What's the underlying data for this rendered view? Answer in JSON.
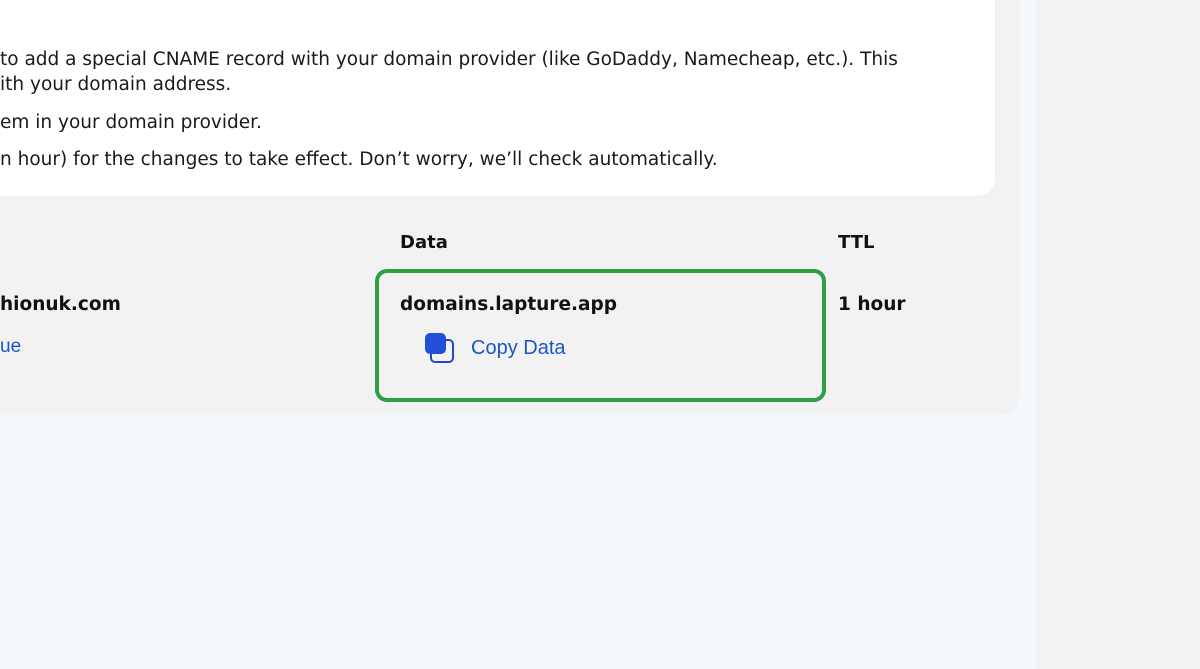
{
  "instructions": {
    "line1": "to add a special CNAME record with your domain provider (like GoDaddy, Namecheap, etc.). This",
    "line2": "ith your domain address.",
    "line3": "em in your domain provider.",
    "line4": "n hour) for the changes to take effect. Don’t worry, we’ll check automatically."
  },
  "table": {
    "headers": {
      "data": "Data",
      "ttl": "TTL"
    },
    "row": {
      "name": "hionuk.com",
      "name_action": "ue",
      "data": "domains.lapture.app",
      "copy_label": "Copy Data",
      "ttl": "1 hour"
    }
  },
  "colors": {
    "highlight": "#2f9e44",
    "link": "#1a56c4",
    "copy_icon": "#2150d6"
  },
  "icons": {
    "copy": "copy-icon"
  }
}
